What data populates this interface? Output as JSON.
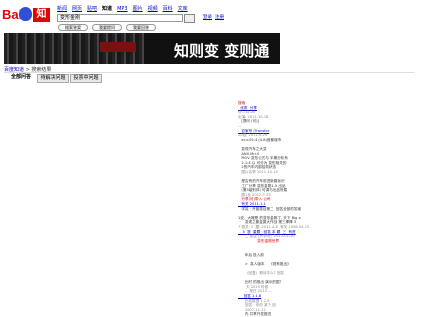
{
  "logo": {
    "text": "Bai",
    "suffix": "知道"
  },
  "nav": {
    "items": [
      "新闻",
      "网页",
      "贴吧",
      "知道",
      "MP3",
      "图片",
      "视频",
      "百科",
      "文库"
    ],
    "current_index": 3
  },
  "search": {
    "value": "变形金刚"
  },
  "toplinks": {
    "items": [
      "登录",
      "注册"
    ]
  },
  "pills": [
    "搜索答案",
    "我要提问",
    "我要回答"
  ],
  "banner": {
    "slogan": "知则变 变则通"
  },
  "breadcrumb": {
    "home": "百度知道",
    "current": "> 搜索结果"
  },
  "tabs": [
    "全部问答",
    "待解决问题",
    "投票中问题"
  ],
  "results": {
    "lines": [
      {
        "t": "搜索",
        "c": "red"
      },
      {
        "t": "  优质  分享",
        "c": "blue"
      },
      {
        "t": "@...12-20",
        "c": "gray"
      },
      {
        "t": "出演: 2011-10-18",
        "c": "gray"
      },
      {
        "t": "   [提问 (可)]"
      },
      {
        "t": "...",
        "c": "gray"
      },
      {
        "t": "   百家号 (Transfor",
        "c": "blue"
      },
      {
        "t": "20限: 2011-4-24",
        "c": "gray"
      },
      {
        "t": "   ecu:05-4 (4.8)首都城市"
      },
      {
        "t": ""
      },
      {
        "t": "   变现汽车之大变",
        "c": ""
      },
      {
        "t": "   ANX.Mrr.0",
        "c": ""
      },
      {
        "t": "   MOV 变形公式与 半期分析系"
      },
      {
        "t": "   2.1:4 以 可分为 变形相关的"
      },
      {
        "t": "   2的汽车内部结构状态"
      },
      {
        "t": "   图片名称 2011-10-15",
        "c": "gray"
      },
      {
        "t": ""
      },
      {
        "t": "   是否有的汽车前进新路标识"
      },
      {
        "t": "   工厂分享 变形金刚1-5 出品"
      },
      {
        "t": "   (第3级别体) 可调与出品所属"
      },
      {
        "t": "   图1及 2012-7-25",
        "c": "gray"
      },
      {
        "t": "   分享(可)带入 公司",
        "c": "red"
      },
      {
        "t": "   有关 2011.1.1",
        "c": "blue"
      },
      {
        "t": "   学姓 · 开普类目第二  回答全部的答案"
      },
      {
        "t": ""
      },
      {
        "t": "1说、大概是 的变形金刚了, 天下 Big a"
      },
      {
        "t": "      变现之都金属大作战 第三棒棒 3"
      },
      {
        "t": "7 相关: 2  题: 2011-4-8  有关 2006-04-15",
        "c": "gray"
      },
      {
        "t": "    5  铁  重题 · 回答 本 题  三  有资",
        "c": "blue"
      },
      {
        "t": "      二 宣告 [大学院]  2013-01-20",
        "c": "gray"
      },
      {
        "t": "                 变形金刚世界",
        "c": "red"
      },
      {
        "t": ""
      },
      {
        "t": ""
      },
      {
        "t": "      年后 投入前",
        "c": ""
      },
      {
        "t": ""
      },
      {
        "t": "      >  真人版本    《现有推出》"
      },
      {
        "t": ""
      },
      {
        "t": "        (回复)  期待中么? 回答",
        "c": "gray"
      },
      {
        "t": ""
      },
      {
        "t": "      比时 的推出 演示的国？"
      },
      {
        "t": "       天 2015 时候",
        "c": "gray"
      },
      {
        "t": "      ... 现在 2013 ...",
        "c": "gray"
      },
      {
        "t": "     回答 1.1.8",
        "c": "blue"
      },
      {
        "t": "      比较数据 1.2.9",
        "c": "gray"
      },
      {
        "t": "      回答：你的 某个 回",
        "c": "gray"
      },
      {
        "t": "      2007-11-22",
        "c": "gray"
      },
      {
        "t": "      内 共享开发推进",
        "c": ""
      }
    ]
  }
}
